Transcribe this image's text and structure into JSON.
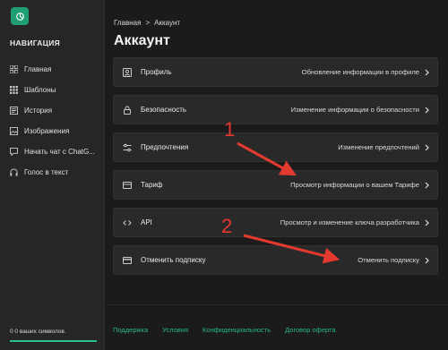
{
  "nav": {
    "heading": "НАВИГАЦИЯ",
    "items": [
      {
        "label": "Главная",
        "icon": "grid-icon"
      },
      {
        "label": "Шаблоны",
        "icon": "templates-icon"
      },
      {
        "label": "История",
        "icon": "history-icon"
      },
      {
        "label": "Изображения",
        "icon": "image-icon"
      },
      {
        "label": "Начать чат с ChatG...",
        "icon": "chat-icon"
      },
      {
        "label": "Голос в текст",
        "icon": "headphones-icon"
      }
    ]
  },
  "sidebar_footer": {
    "symbols_text": "0 0 ваших символов.",
    "progress": 1.0
  },
  "breadcrumb": {
    "home": "Главная",
    "separator": ">",
    "current": "Аккаунт"
  },
  "page_title": "Аккаунт",
  "cards": [
    {
      "label": "Профиль",
      "desc": "Обновление информации в профиле",
      "icon": "user-icon"
    },
    {
      "label": "Безопасность",
      "desc": "Изменение информации о безопасности",
      "icon": "lock-icon"
    },
    {
      "label": "Предпочтения",
      "desc": "Изменение предпочтений",
      "icon": "sliders-icon"
    },
    {
      "label": "Тариф",
      "desc": "Просмотр информации о вашем Тарифе",
      "icon": "tariff-icon"
    },
    {
      "label": "API",
      "desc": "Просмотр и изменение ключа разработчика",
      "icon": "code-icon"
    },
    {
      "label": "Отменить подписку",
      "desc": "Отменить подписку",
      "icon": "card-icon"
    }
  ],
  "footer_links": [
    "Поддержка",
    "Условия",
    "Конфиденциальность",
    "Договор оферта"
  ],
  "annotations": {
    "first": "1",
    "second": "2"
  },
  "colors": {
    "accent": "#26c08a",
    "arrow": "#e33a2f",
    "card_bg": "#292929",
    "sidebar_bg": "#262626"
  }
}
